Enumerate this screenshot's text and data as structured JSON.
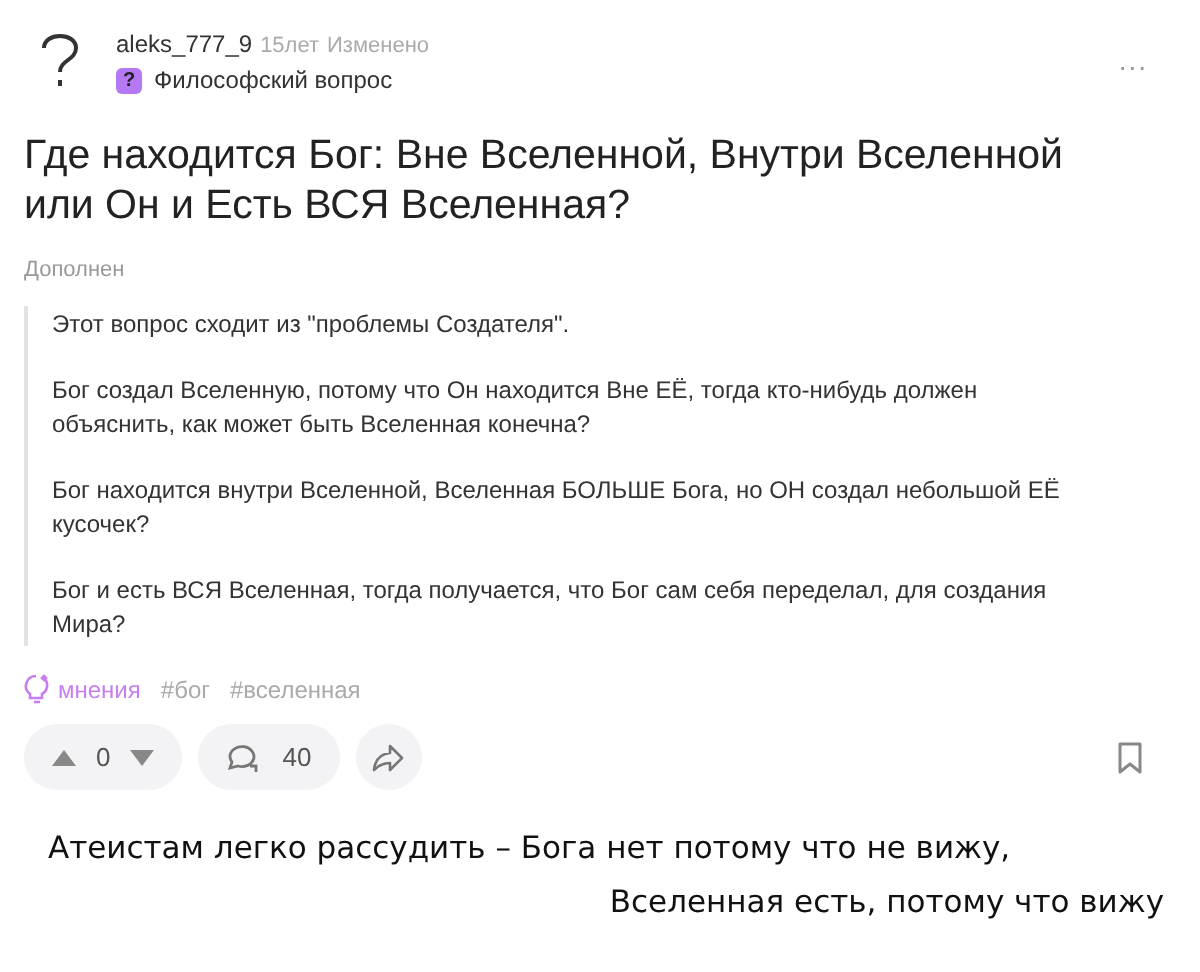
{
  "post": {
    "author": "aleks_777_9",
    "age": "15лет",
    "edited": "Изменено",
    "category": "Философский вопрос",
    "category_icon": "?",
    "more": "...",
    "title": "Где находится Бог: Вне Вселенной, Внутри Вселенной или Он и Есть ВСЯ Вселенная?",
    "supplement_label": "Дополнен",
    "paragraphs": [
      "Этот вопрос сходит из \"проблемы Создателя\".",
      "Бог создал Вселенную, потому что Он находится Вне ЕЁ, тогда кто-нибудь должен объяснить, как может быть Вселенная конечна?",
      "Бог находится внутри Вселенной, Вселенная БОЛЬШЕ Бога, но ОН создал небольшой ЕЁ кусочек?",
      "Бог и есть ВСЯ Вселенная, тогда получается, что Бог сам себя переделал, для создания Мира?"
    ],
    "tags": [
      {
        "kind": "topic",
        "label": "мнения"
      },
      {
        "kind": "hashtag",
        "label": "#бог"
      },
      {
        "kind": "hashtag",
        "label": "#вселенная"
      }
    ],
    "votes": "0",
    "comments": "40"
  },
  "caption": [
    "Атеистам легко рассудить – Бога нет потому что не вижу,",
    "Вселенная есть, потому что вижу"
  ]
}
